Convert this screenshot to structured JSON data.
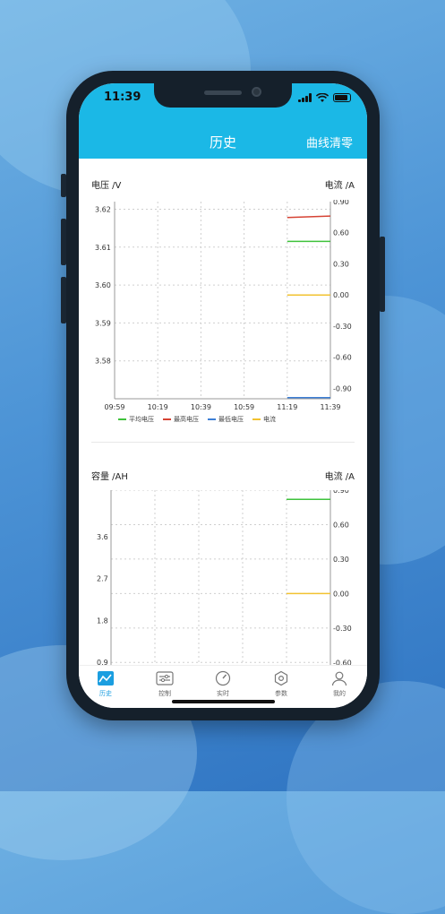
{
  "status": {
    "time": "11:39"
  },
  "header": {
    "title": "历史",
    "clear_label": "曲线清零"
  },
  "colors": {
    "header_bg": "#1bb8e6",
    "avg_voltage": "#3fc23c",
    "max_voltage": "#d64334",
    "min_voltage": "#3d7fd6",
    "current": "#f2c230",
    "active_tab": "#1b9ee0"
  },
  "chart_data": [
    {
      "type": "line",
      "y_label_left": "电压 /V",
      "y_label_right": "电流 /A",
      "x_ticks": [
        "09:59",
        "10:19",
        "10:39",
        "10:59",
        "11:19",
        "11:39"
      ],
      "y_left_ticks": [
        "3.62",
        "3.61",
        "3.60",
        "3.59",
        "3.58"
      ],
      "y_left_range": [
        3.57,
        3.622
      ],
      "y_right_ticks": [
        "0.90",
        "0.60",
        "0.30",
        "0.00",
        "-0.30",
        "-0.60",
        "-0.90"
      ],
      "y_right_range": [
        -1.0,
        0.9
      ],
      "grid": true,
      "legend": [
        "平均电压",
        "最高电压",
        "最低电压",
        "电流"
      ],
      "series": [
        {
          "name": "平均电压",
          "axis": "left",
          "x": [
            "11:19",
            "11:39"
          ],
          "values": [
            3.6115,
            3.6115
          ]
        },
        {
          "name": "最高电压",
          "axis": "left",
          "x": [
            "11:19",
            "11:39"
          ],
          "values": [
            3.6178,
            3.6182
          ]
        },
        {
          "name": "最低电压",
          "axis": "left",
          "x": [
            "11:19",
            "11:39"
          ],
          "values": [
            3.5703,
            3.5703
          ]
        },
        {
          "name": "电流",
          "axis": "right",
          "x": [
            "11:19",
            "11:39"
          ],
          "values": [
            0.0,
            0.0
          ]
        }
      ]
    },
    {
      "type": "line",
      "y_label_left": "容量 /AH",
      "y_label_right": "电流 /A",
      "y_left_ticks": [
        "3.6",
        "2.7",
        "1.8",
        "0.9"
      ],
      "y_left_range": [
        0.75,
        4.6
      ],
      "y_right_ticks": [
        "0.90",
        "0.60",
        "0.30",
        "0.00",
        "-0.30",
        "-0.60"
      ],
      "y_right_range": [
        -0.66,
        0.9
      ],
      "grid": true,
      "series": [
        {
          "axis": "right",
          "values": [
            0.82,
            0.82
          ]
        },
        {
          "axis": "right",
          "values": [
            0.0,
            0.0
          ]
        }
      ]
    }
  ],
  "tabs": [
    {
      "label": "历史",
      "icon": "chart-icon",
      "active": true
    },
    {
      "label": "控制",
      "icon": "sliders-icon",
      "active": false
    },
    {
      "label": "实时",
      "icon": "gauge-icon",
      "active": false
    },
    {
      "label": "参数",
      "icon": "hexagon-gear-icon",
      "active": false
    },
    {
      "label": "我的",
      "icon": "user-icon",
      "active": false
    }
  ]
}
